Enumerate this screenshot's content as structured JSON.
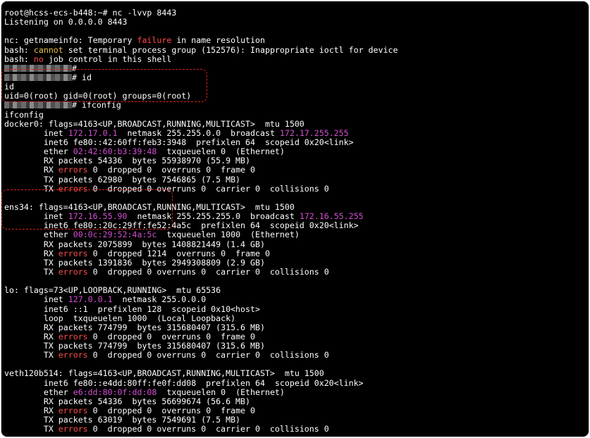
{
  "lines": [
    [
      {
        "t": "root@hcss-ecs-b448:~# nc -lvvp 8443"
      }
    ],
    [
      {
        "t": "Listening on 0.0.0.0 8443"
      }
    ],
    [],
    [
      {
        "t": "nc: getnameinfo: Temporary "
      },
      {
        "t": "failure",
        "c": "err"
      },
      {
        "t": " in name resolution"
      }
    ],
    [
      {
        "t": "bash: "
      },
      {
        "t": "cannot",
        "c": "warn"
      },
      {
        "t": " set terminal process group (152576): Inappropriate ioctl for device"
      }
    ],
    [
      {
        "t": "bash: "
      },
      {
        "t": "no",
        "c": "err"
      },
      {
        "t": " job control in this shell"
      }
    ],
    [
      {
        "r": 96
      },
      {
        "t": "#"
      }
    ],
    [
      {
        "r": 96
      },
      {
        "t": "# id"
      }
    ],
    [
      {
        "t": "id"
      }
    ],
    [
      {
        "t": "uid=0(root) gid=0(root) groups=0(root)"
      }
    ],
    [
      {
        "r": 96
      },
      {
        "t": "# ifconfig"
      }
    ],
    [
      {
        "t": "ifconfig"
      }
    ],
    [
      {
        "t": "docker0: flags=4163<UP,BROADCAST,RUNNING,MULTICAST>  mtu 1500"
      }
    ],
    [
      {
        "t": "        inet "
      },
      {
        "t": "172.17.0.1",
        "c": "mag"
      },
      {
        "t": "  netmask 255.255.0.0  broadcast "
      },
      {
        "t": "172.17.255.255",
        "c": "mag"
      }
    ],
    [
      {
        "t": "        inet6 fe80::42:60ff:feb3:3948  prefixlen 64  scopeid 0x20<link>"
      }
    ],
    [
      {
        "t": "        ether "
      },
      {
        "t": "02:42:60:b3:39:48",
        "c": "mag"
      },
      {
        "t": "  txqueuelen 0  (Ethernet)"
      }
    ],
    [
      {
        "t": "        RX packets 54336  bytes 55938970 (55.9 MB)"
      }
    ],
    [
      {
        "t": "        RX "
      },
      {
        "t": "errors",
        "c": "err"
      },
      {
        "t": " 0  dropped 0  overruns 0  frame 0"
      }
    ],
    [
      {
        "t": "        TX packets 62980  bytes 7546865 (7.5 MB)"
      }
    ],
    [
      {
        "t": "        TX "
      },
      {
        "t": "errors",
        "c": "err"
      },
      {
        "t": " 0  dropped 0 overruns 0  carrier 0  collisions 0"
      }
    ],
    [],
    [
      {
        "t": "ens34: flags=4163<UP,BROADCAST,RUNNING,MULTICAST>  mtu 1500"
      }
    ],
    [
      {
        "t": "        inet "
      },
      {
        "t": "172.16.55.90",
        "c": "mag"
      },
      {
        "t": "  netmask 255.255.255.0  broadcast "
      },
      {
        "t": "172.16.55.255",
        "c": "mag"
      }
    ],
    [
      {
        "t": "        inet6 fe80::20c:29ff:fe52:4a5c  prefixlen 64  scopeid 0x20<link>"
      }
    ],
    [
      {
        "t": "        ether "
      },
      {
        "t": "00:0c:29:52:4a:5c",
        "c": "mag"
      },
      {
        "t": "  txqueuelen 1000  (Ethernet)"
      }
    ],
    [
      {
        "t": "        RX packets 2075899  bytes 1408821449 (1.4 GB)"
      }
    ],
    [
      {
        "t": "        RX "
      },
      {
        "t": "errors",
        "c": "err"
      },
      {
        "t": " 0  dropped 1214  overruns 0  frame 0"
      }
    ],
    [
      {
        "t": "        TX packets 1391836  bytes 2949308809 (2.9 GB)"
      }
    ],
    [
      {
        "t": "        TX "
      },
      {
        "t": "errors",
        "c": "err"
      },
      {
        "t": " 0  dropped 0 overruns 0  carrier 0  collisions 0"
      }
    ],
    [],
    [
      {
        "t": "lo: flags=73<UP,LOOPBACK,RUNNING>  mtu 65536"
      }
    ],
    [
      {
        "t": "        inet "
      },
      {
        "t": "127.0.0.1",
        "c": "mag"
      },
      {
        "t": "  netmask 255.0.0.0"
      }
    ],
    [
      {
        "t": "        inet6 ::1  prefixlen 128  scopeid 0x10<host>"
      }
    ],
    [
      {
        "t": "        loop  txqueuelen 1000  (Local Loopback)"
      }
    ],
    [
      {
        "t": "        RX packets 774799  bytes 315680407 (315.6 MB)"
      }
    ],
    [
      {
        "t": "        RX "
      },
      {
        "t": "errors",
        "c": "err"
      },
      {
        "t": " 0  dropped 0  overruns 0  frame 0"
      }
    ],
    [
      {
        "t": "        TX packets 774799  bytes 315680407 (315.6 MB)"
      }
    ],
    [
      {
        "t": "        TX "
      },
      {
        "t": "errors",
        "c": "err"
      },
      {
        "t": " 0  dropped 0 overruns 0  carrier 0  collisions 0"
      }
    ],
    [],
    [
      {
        "t": "veth120b514: flags=4163<UP,BROADCAST,RUNNING,MULTICAST>  mtu 1500"
      }
    ],
    [
      {
        "t": "        inet6 fe80::e4dd:80ff:fe0f:dd08  prefixlen 64  scopeid 0x20<link>"
      }
    ],
    [
      {
        "t": "        ether "
      },
      {
        "t": "e6:dd:80:0f:dd:08",
        "c": "mag"
      },
      {
        "t": "  txqueuelen 0  (Ethernet)"
      }
    ],
    [
      {
        "t": "        RX packets 54336  bytes 56699674 (56.6 MB)"
      }
    ],
    [
      {
        "t": "        RX "
      },
      {
        "t": "errors",
        "c": "err"
      },
      {
        "t": " 0  dropped 0  overruns 0  frame 0"
      }
    ],
    [
      {
        "t": "        TX packets 63019  bytes 7549691 (7.5 MB)"
      }
    ],
    [
      {
        "t": "        TX "
      },
      {
        "t": "errors",
        "c": "err"
      },
      {
        "t": " 0  dropped 0 overruns 0  carrier 0  collisions 0"
      }
    ]
  ],
  "colors": {
    "background": "#000000",
    "text": "#ffffff",
    "error": "#ff4d4d",
    "warning": "#e5c24a",
    "address": "#d24fd2",
    "annotation": "#e02020"
  }
}
